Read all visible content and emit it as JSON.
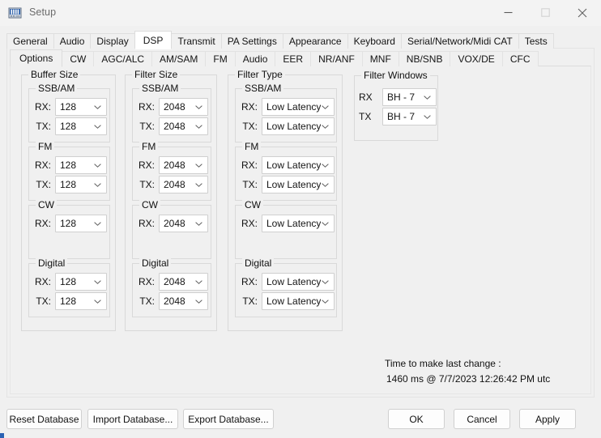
{
  "window": {
    "title": "Setup",
    "icon": "radio-device-icon",
    "minimize_label": "Minimize",
    "maximize_label": "Maximize",
    "close_label": "Close"
  },
  "tabs": {
    "selected": "DSP",
    "items": [
      {
        "label": "General"
      },
      {
        "label": "Audio"
      },
      {
        "label": "Display"
      },
      {
        "label": "DSP"
      },
      {
        "label": "Transmit"
      },
      {
        "label": "PA Settings"
      },
      {
        "label": "Appearance"
      },
      {
        "label": "Keyboard"
      },
      {
        "label": "Serial/Network/Midi CAT"
      },
      {
        "label": "Tests"
      }
    ]
  },
  "subtabs": {
    "selected": "Options",
    "items": [
      {
        "label": "Options"
      },
      {
        "label": "CW"
      },
      {
        "label": "AGC/ALC"
      },
      {
        "label": "AM/SAM"
      },
      {
        "label": "FM"
      },
      {
        "label": "Audio"
      },
      {
        "label": "EER"
      },
      {
        "label": "NR/ANF"
      },
      {
        "label": "MNF"
      },
      {
        "label": "NB/SNB"
      },
      {
        "label": "VOX/DE"
      },
      {
        "label": "CFC"
      }
    ]
  },
  "groups": {
    "buffer_size": {
      "title": "Buffer Size",
      "sections": [
        {
          "title": "SSB/AM",
          "rows": [
            {
              "label": "RX:",
              "value": "128"
            },
            {
              "label": "TX:",
              "value": "128"
            }
          ]
        },
        {
          "title": "FM",
          "rows": [
            {
              "label": "RX:",
              "value": "128"
            },
            {
              "label": "TX:",
              "value": "128"
            }
          ]
        },
        {
          "title": "CW",
          "rows": [
            {
              "label": "RX:",
              "value": "128"
            }
          ]
        },
        {
          "title": "Digital",
          "rows": [
            {
              "label": "RX:",
              "value": "128"
            },
            {
              "label": "TX:",
              "value": "128"
            }
          ]
        }
      ]
    },
    "filter_size": {
      "title": "Filter Size",
      "sections": [
        {
          "title": "SSB/AM",
          "rows": [
            {
              "label": "RX:",
              "value": "2048"
            },
            {
              "label": "TX:",
              "value": "2048"
            }
          ]
        },
        {
          "title": "FM",
          "rows": [
            {
              "label": "RX:",
              "value": "2048"
            },
            {
              "label": "TX:",
              "value": "2048"
            }
          ]
        },
        {
          "title": "CW",
          "rows": [
            {
              "label": "RX:",
              "value": "2048"
            }
          ]
        },
        {
          "title": "Digital",
          "rows": [
            {
              "label": "RX:",
              "value": "2048"
            },
            {
              "label": "TX:",
              "value": "2048"
            }
          ]
        }
      ]
    },
    "filter_type": {
      "title": "Filter Type",
      "sections": [
        {
          "title": "SSB/AM",
          "rows": [
            {
              "label": "RX:",
              "value": "Low Latency"
            },
            {
              "label": "TX:",
              "value": "Low Latency"
            }
          ]
        },
        {
          "title": "FM",
          "rows": [
            {
              "label": "RX:",
              "value": "Low Latency"
            },
            {
              "label": "TX:",
              "value": "Low Latency"
            }
          ]
        },
        {
          "title": "CW",
          "rows": [
            {
              "label": "RX:",
              "value": "Low Latency"
            }
          ]
        },
        {
          "title": "Digital",
          "rows": [
            {
              "label": "RX:",
              "value": "Low Latency"
            },
            {
              "label": "TX:",
              "value": "Low Latency"
            }
          ]
        }
      ]
    },
    "filter_windows": {
      "title": "Filter Windows",
      "rows": [
        {
          "label": "RX",
          "value": "BH - 7"
        },
        {
          "label": "TX",
          "value": "BH - 7"
        }
      ]
    }
  },
  "status": {
    "line1": "Time to make last change :",
    "line2": "1460 ms @ 7/7/2023 12:26:42 PM utc"
  },
  "buttons": {
    "reset_database": "Reset Database",
    "import_database": "Import Database...",
    "export_database": "Export Database...",
    "ok": "OK",
    "cancel": "Cancel",
    "apply": "Apply"
  },
  "colors": {
    "window_bg": "#f0f0f0",
    "titlebar_bg": "#f3f3f3",
    "combo_bg": "#ffffff",
    "group_border": "#d9d9d9",
    "accent": "#2a62b4"
  }
}
